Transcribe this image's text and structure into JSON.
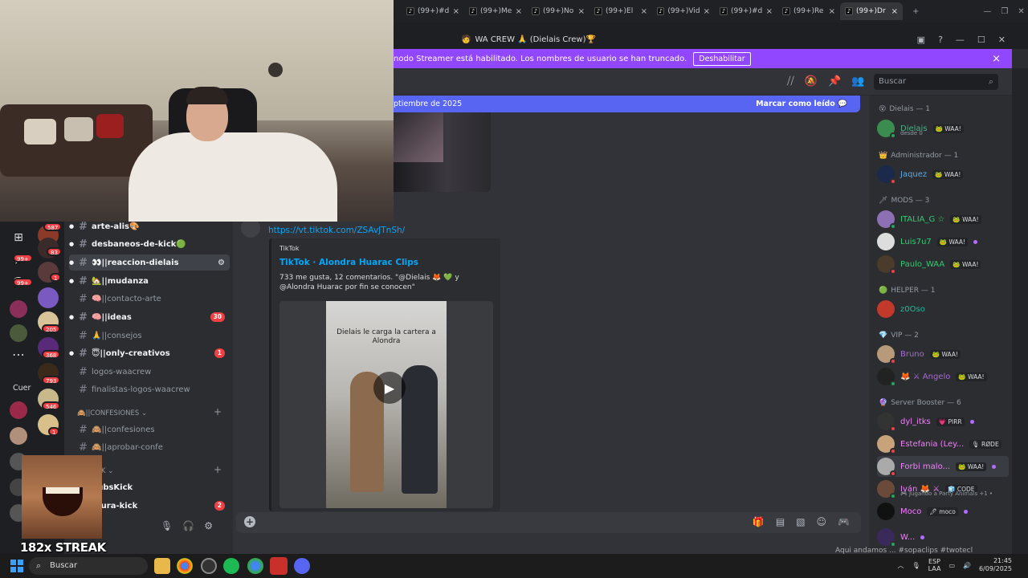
{
  "chrome": {
    "tabs": [
      {
        "label": "(99+)#d",
        "active": false
      },
      {
        "label": "(99+)Me",
        "active": false
      },
      {
        "label": "(99+)No",
        "active": false
      },
      {
        "label": "(99+)El",
        "active": false
      },
      {
        "label": "(99+)Vid",
        "active": false
      },
      {
        "label": "(99+)#d",
        "active": false
      },
      {
        "label": "(99+)Re",
        "active": false
      },
      {
        "label": "(99+)Dr",
        "active": true
      }
    ],
    "new_tab": "+",
    "close_glyph": "×"
  },
  "window": {
    "title": "WA CREW 🙏 (Dielais Crew)🏆"
  },
  "banner": {
    "text": "nodo Streamer está habilitado. Los nombres de usuario se han truncado.",
    "button": "Deshabilitar",
    "close": "×"
  },
  "header": {
    "search_placeholder": "Buscar"
  },
  "new_messages": {
    "date_text": "ptiembre de 2025",
    "mark_read": "Marcar como leído"
  },
  "message": {
    "author_partial": "...",
    "link": "https://vt.tiktok.com/ZSAvJTnSh/",
    "embed": {
      "provider": "TikTok",
      "title": "TikTok · Alondra Huarac Clips",
      "description": "733 me gusta, 12 comentarios. \"@Dielais 🦊 💚 y @Alondra Huarac por fin se conocen\"",
      "video_caption": "Dielais le carga la cartera a Alondra",
      "play": "▶"
    }
  },
  "members": {
    "groups": [
      {
        "label": "Dielais — 1"
      },
      {
        "label": "Administrador — 1"
      },
      {
        "label": "MODS — 3"
      },
      {
        "label": "HELPER — 1"
      },
      {
        "label": "VIP — 2"
      },
      {
        "label": "Server Booster — 6"
      }
    ],
    "list": [
      {
        "name": "Dielais",
        "tag": "🐸 WAA!",
        "sub": "desde 0",
        "color": "#43b581"
      },
      {
        "name": "Jaquez",
        "tag": "🐸 WAA!",
        "sub": "",
        "color": "#5aa9e6"
      },
      {
        "name": "ITALIA_G ☆",
        "tag": "🐸 WAA!",
        "sub": "",
        "color": "#2ecc71"
      },
      {
        "name": "Luis7u7",
        "tag": "🐸 WAA!",
        "sub": "",
        "color": "#2ecc71"
      },
      {
        "name": "Paulo_WAA",
        "tag": "🐸 WAA!",
        "sub": "",
        "color": "#2ecc71"
      },
      {
        "name": "z0Oso",
        "tag": "",
        "sub": "",
        "color": "#1abc9c"
      },
      {
        "name": "Bruno",
        "tag": "🐸 WAA!",
        "sub": "",
        "color": "#a66bd3"
      },
      {
        "name": "🦊 ⚔ Angelo",
        "tag": "🐸 WAA!",
        "sub": "",
        "color": "#a66bd3"
      },
      {
        "name": "dyl_itks",
        "tag": "💗 PIRR",
        "sub": "",
        "color": "#f47fff"
      },
      {
        "name": "Estefania (Ley...",
        "tag": "🎙 RØDE",
        "sub": "",
        "color": "#f47fff"
      },
      {
        "name": "Forbi malo...",
        "tag": "🐸 WAA!",
        "sub": "",
        "color": "#f47fff"
      },
      {
        "name": "Iván 🦊 ⚔",
        "tag": "🧊 CODE",
        "sub": "🎮 Jugando a Party Animals +1 •",
        "color": "#f47fff"
      },
      {
        "name": "Moco",
        "tag": "🖊 moco",
        "sub": "",
        "color": "#f47fff"
      },
      {
        "name": "W...",
        "tag": "",
        "sub": "",
        "color": "#f47fff"
      }
    ]
  },
  "channels": [
    {
      "name": "arte-alis🎨",
      "unread": true,
      "badge": ""
    },
    {
      "name": "desbaneos-de-kick🟢",
      "unread": true,
      "badge": ""
    },
    {
      "name": "👀||reaccion-dielais",
      "unread": true,
      "badge": "",
      "active": true
    },
    {
      "name": "🏡||mudanza",
      "unread": true,
      "badge": ""
    },
    {
      "name": "🧠||contacto-arte",
      "unread": false,
      "badge": ""
    },
    {
      "name": "🧠||ideas",
      "unread": true,
      "badge": "30"
    },
    {
      "name": "🙏||consejos",
      "unread": false,
      "badge": ""
    },
    {
      "name": "😇||only-creativos",
      "unread": true,
      "badge": "1"
    },
    {
      "name": "logos-waacrew",
      "unread": false,
      "badge": ""
    },
    {
      "name": "finalistas-logos-waacrew",
      "unread": false,
      "badge": ""
    }
  ],
  "categories": {
    "confesiones": "🙈||CONFESIONES ⌄",
    "kick": "CK ⌄"
  },
  "channels2": [
    {
      "name": "🙈||confesiones",
      "unread": false,
      "badge": ""
    },
    {
      "name": "🙈||aprobar-confe",
      "unread": false,
      "badge": ""
    },
    {
      "name": "SubsKick",
      "unread": true,
      "badge": ""
    },
    {
      "name": "otura-kick",
      "unread": true,
      "badge": "2"
    }
  ],
  "guild_badges": [
    "587",
    "83",
    "1",
    "205",
    "368",
    "793",
    "546",
    "1"
  ],
  "server_badges": [
    "99+",
    "99+"
  ],
  "side_label": "Cuer",
  "overlay": {
    "streak": "182x STREAK"
  },
  "bottom_text": "Aqui andamos ... #sopaclips #twotecl",
  "taskbar": {
    "search": "Buscar",
    "lang_top": "ESP",
    "lang_bottom": "LAA",
    "time": "21:45",
    "date": "6/09/2025"
  }
}
